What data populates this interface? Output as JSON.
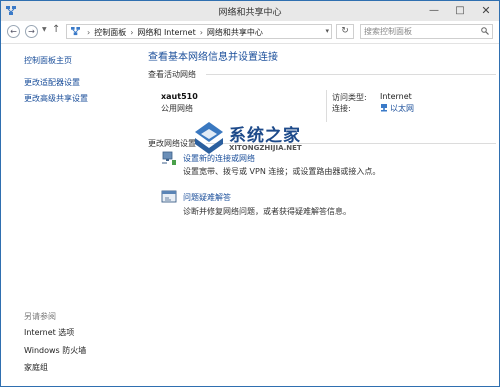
{
  "window": {
    "title": "网络和共享中心",
    "controls": {
      "minimize": "—",
      "maximize": "□",
      "close": "✕"
    }
  },
  "address_bar": {
    "breadcrumbs": [
      "控制面板",
      "网络和 Internet",
      "网络和共享中心"
    ],
    "separator": "›",
    "search_placeholder": "搜索控制面板",
    "back_icon": "back-arrow-icon",
    "forward_icon": "forward-arrow-icon",
    "up_icon": "up-arrow-icon",
    "refresh_icon": "refresh-icon"
  },
  "sidebar": {
    "items": [
      {
        "label": "控制面板主页"
      },
      {
        "label": "更改适配器设置"
      },
      {
        "label": "更改高级共享设置"
      }
    ],
    "see_also_header": "另请参阅",
    "see_also": [
      {
        "label": "Internet 选项"
      },
      {
        "label": "Windows 防火墙"
      },
      {
        "label": "家庭组"
      }
    ]
  },
  "main": {
    "title": "查看基本网络信息并设置连接",
    "active_networks_header": "查看活动网络",
    "network": {
      "name": "xaut510",
      "type": "公用网络",
      "access_type_label": "访问类型:",
      "access_type_value": "Internet",
      "connections_label": "连接:",
      "connections_value": "以太网"
    },
    "change_settings_header": "更改网络设置",
    "items": [
      {
        "link": "设置新的连接或网络",
        "desc": "设置宽带、拨号或 VPN 连接；或设置路由器或接入点。",
        "icon": "network-setup-icon"
      },
      {
        "link": "问题疑难解答",
        "desc": "诊断并修复网络问题，或者获得疑难解答信息。",
        "icon": "troubleshoot-icon"
      }
    ]
  },
  "watermark": {
    "name": "系统之家",
    "url": "XITONGZHIJIA.NET"
  },
  "colors": {
    "link": "#1a4e9a",
    "border": "#2f6fb0",
    "titlebar": "#e8e8e8"
  }
}
